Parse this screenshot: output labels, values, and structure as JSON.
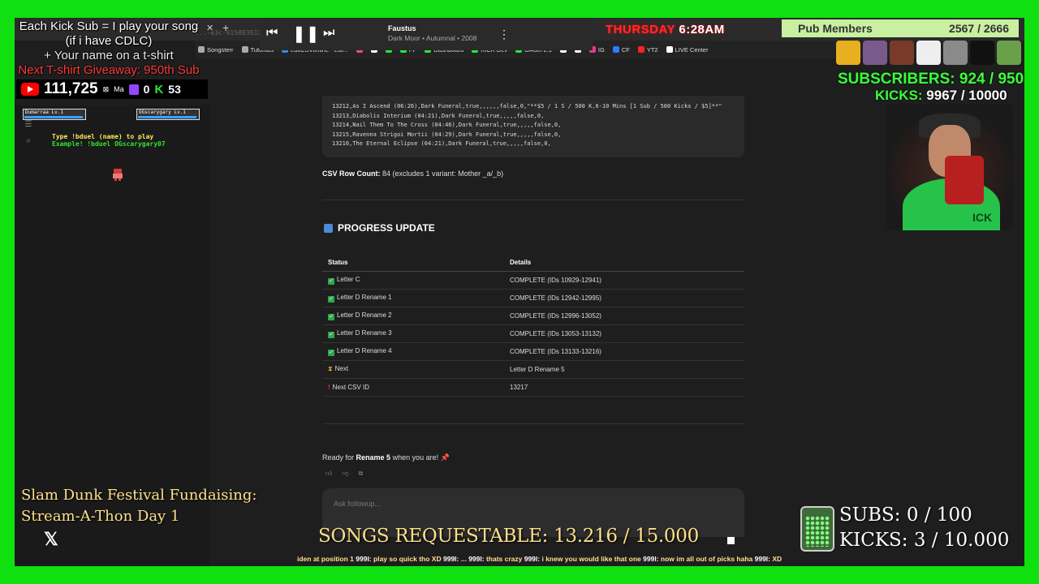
{
  "overlay": {
    "kick_sub_lines": [
      "Each Kick Sub = I play your song",
      "(if i have CDLC)",
      "+ Your name on a t-shirt",
      "Next T-shirt Giveaway: 950th Sub"
    ],
    "youtube_count": "111,725",
    "social_small_label": "Ma",
    "twitch_count": "0",
    "kick_count": "53",
    "date_label": "THURSDAY",
    "time_label": "6:28AM",
    "pub_members_label": "Pub Members",
    "pub_members_value": "2567 / 2666",
    "subscribers_label": "SUBSCRIBERS:",
    "subscribers_value": "924 / 950",
    "kicks_label": "KICKS:",
    "kicks_value": "9967 / 10000",
    "webcam_label": "ICK",
    "fundraise_line1": "Slam Dunk Festival Fundaising:",
    "fundraise_line2": "Stream-A-Thon Day 1",
    "songs_requestable": "SONGS REQUESTABLE: 13.216 / 15.000",
    "subs_goal": "SUBS:  0 / 100",
    "kicks_goal": "KICKS: 3 / 10.000",
    "ticker": [
      {
        "u": "",
        "t": "iden at position 1 "
      },
      {
        "u": "999l: ",
        "t": "play so quick tho XD "
      },
      {
        "u": "999l: ",
        "t": "... "
      },
      {
        "u": "999l: ",
        "t": "thats crazy "
      },
      {
        "u": "999l: ",
        "t": "i knew you would like that one "
      },
      {
        "u": "999l: ",
        "t": "now im all out of picks haha "
      },
      {
        "u": "999l: ",
        "t": "XD"
      }
    ]
  },
  "browser": {
    "url_fragment": "...-e3c-9158839332e5",
    "bookmarks": [
      "Songsterr",
      "Tutorials",
      "editCSVonline - Edi...",
      "",
      "",
      "",
      "FP",
      "Dashboard",
      "KICK Dev",
      "OAuth 2.1",
      "",
      "",
      "IG",
      "CF",
      "YT2",
      "LIVE Center"
    ]
  },
  "game": {
    "player1": "Dumarraa",
    "player1_lv": "Lv.1",
    "player2": "OGscarygary",
    "player2_lv": "Lv.1",
    "instruction": "Type !bduel (name) to play",
    "example": "Example! !bduel OGscarygary07"
  },
  "player": {
    "title": "Faustus",
    "subtitle": "Dark Moor • Autumnal • 2008"
  },
  "doc": {
    "code_lines": [
      "13212,As I Ascend (06:26),Dark Funeral,true,,,,,,false,0,\"**$5 / 1 S / 500 K,6-10 Mins [1 Sub / 500 Kicks / $5]**\"",
      "13213,Diabolis Interium (04:21),Dark Funeral,true,,,,,false,0,",
      "13214,Nail Them To The Cross (04:46),Dark Funeral,true,,,,,false,0,",
      "13215,Ravenna Strigoi Mortii (04:29),Dark Funeral,true,,,,,false,0,",
      "13216,The Eternal Eclipse (04:21),Dark Funeral,true,,,,,false,0,"
    ],
    "csv_count_label": "CSV Row Count:",
    "csv_count_rest": "84 (excludes 1 variant: Mother _a/_b)",
    "progress_title": "PROGRESS UPDATE",
    "table_headers": [
      "Status",
      "Details"
    ],
    "rows": [
      {
        "icon": "check",
        "status": "Letter C",
        "details": "COMPLETE (IDs 10929-12941)"
      },
      {
        "icon": "check",
        "status": "Letter D Rename 1",
        "details": "COMPLETE (IDs 12942-12995)"
      },
      {
        "icon": "check",
        "status": "Letter D Rename 2",
        "details": "COMPLETE (IDs 12996-13052)"
      },
      {
        "icon": "check",
        "status": "Letter D Rename 3",
        "details": "COMPLETE (IDs 13053-13132)"
      },
      {
        "icon": "check",
        "status": "Letter D Rename 4",
        "details": "COMPLETE (IDs 13133-13216)"
      },
      {
        "icon": "hourglass",
        "status": "Next",
        "details": "Letter D Rename 5"
      },
      {
        "icon": "exclamation",
        "status": "Next CSV ID",
        "details": "13217"
      }
    ],
    "ready_prefix": "Ready for ",
    "ready_bold": "Rename 5",
    "ready_suffix": " when you are! 📌",
    "followup_placeholder": "Ask followup..."
  },
  "colors": {
    "frame_green": "#10e010",
    "accent_green": "#3aff3a",
    "date_red": "#ff2a2a",
    "overlay_gold": "#ffe08a"
  }
}
